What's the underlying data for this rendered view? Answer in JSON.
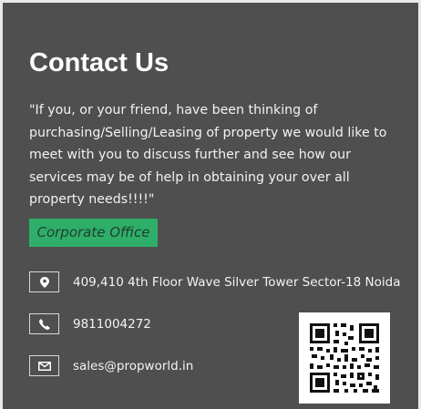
{
  "contact": {
    "title": "Contact Us",
    "quote": "\"If you, or your friend, have been thinking of purchasing/Selling/Leasing of property we would like to meet with you to discuss further and see how our services may be of help in obtaining your over all property needs!!!!\"",
    "office_label": "Corporate Office",
    "address": "409,410 4th Floor Wave Silver Tower Sector-18 Noida",
    "phone": "9811004272",
    "email": "sales@propworld.in"
  },
  "icons": {
    "address": "map-marker-icon",
    "phone": "phone-icon",
    "email": "envelope-icon",
    "qr": "qr-code"
  },
  "colors": {
    "panel_background": "#4f4f4f",
    "text": "#ffffff",
    "badge_background": "#2fae6a",
    "badge_text": "#1f3f2c"
  }
}
